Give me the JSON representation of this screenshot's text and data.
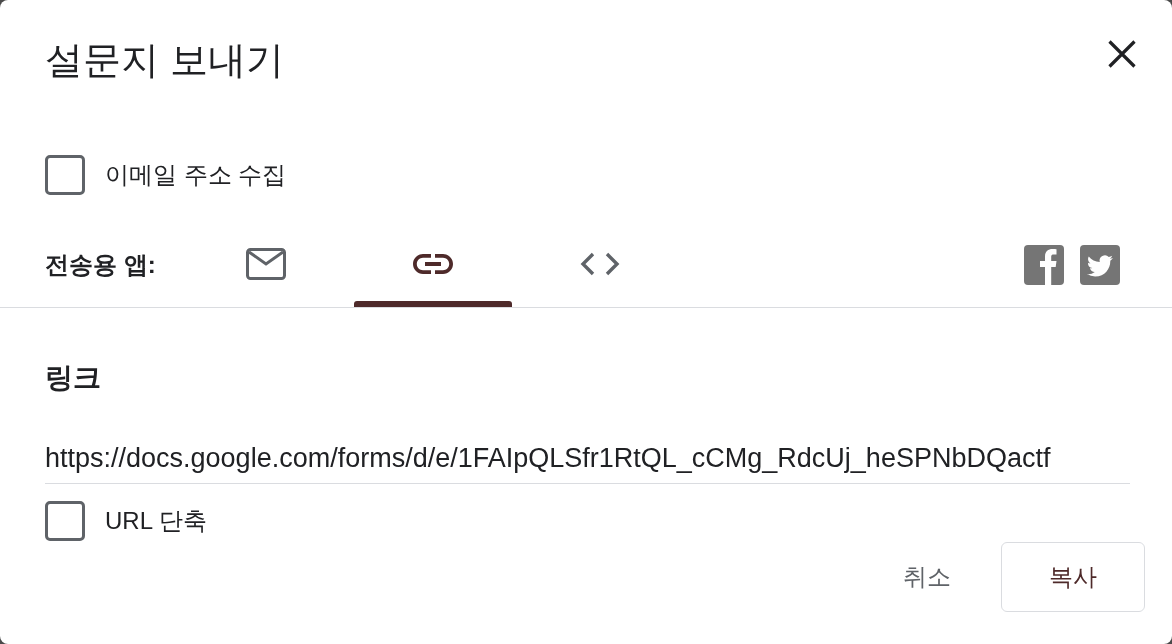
{
  "title": "설문지 보내기",
  "collect_email": {
    "label": "이메일 주소 수집",
    "checked": false
  },
  "send_via": {
    "label": "전송용 앱:",
    "tabs": [
      {
        "kind": "email",
        "selected": false
      },
      {
        "kind": "link",
        "selected": true
      },
      {
        "kind": "embed",
        "selected": false
      }
    ],
    "share": [
      {
        "kind": "facebook"
      },
      {
        "kind": "twitter"
      }
    ]
  },
  "link": {
    "heading": "링크",
    "url": "https://docs.google.com/forms/d/e/1FAIpQLSfr1RtQL_cCMg_RdcUj_heSPNbDQactf",
    "shorten_url": {
      "label": "URL 단축",
      "checked": false
    }
  },
  "buttons": [
    {
      "kind": "text",
      "label": "취소"
    },
    {
      "kind": "outlined",
      "label": "복사"
    }
  ]
}
